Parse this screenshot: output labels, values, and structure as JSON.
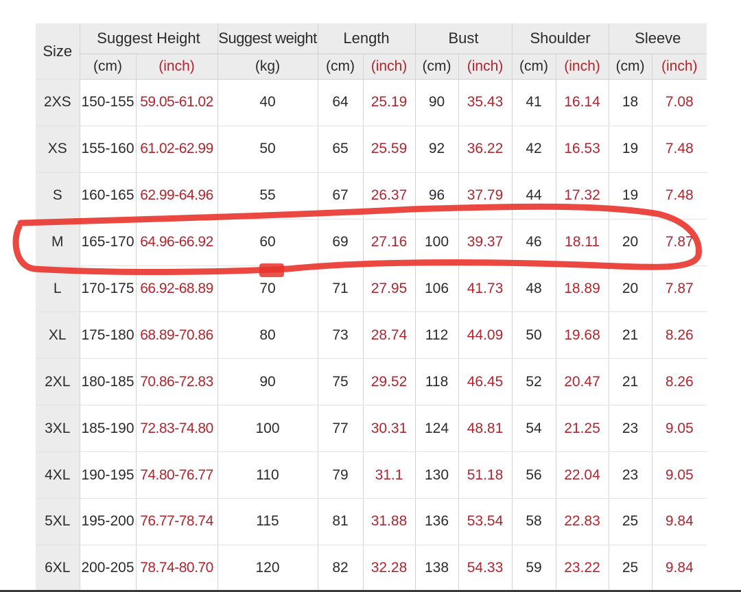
{
  "table": {
    "header": {
      "size": "Size",
      "suggest_height": "Suggest Height",
      "suggest_weight": "Suggest weight",
      "length": "Length",
      "bust": "Bust",
      "shoulder": "Shoulder",
      "sleeve": "Sleeve"
    },
    "units": {
      "height_cm": "(cm)",
      "height_inch": "(inch)",
      "weight_kg": "(kg)",
      "length_cm": "(cm)",
      "length_inch": "(inch)",
      "bust_cm": "(cm)",
      "bust_inch": "(inch)",
      "shoulder_cm": "(cm)",
      "shoulder_inch": "(inch)",
      "sleeve_cm": "(cm)",
      "sleeve_inch": "(inch)"
    },
    "rows": [
      {
        "size": "2XS",
        "height_cm": "150-155",
        "height_inch": "59.05-61.02",
        "weight_kg": "40",
        "length_cm": "64",
        "length_inch": "25.19",
        "bust_cm": "90",
        "bust_inch": "35.43",
        "shoulder_cm": "41",
        "shoulder_inch": "16.14",
        "sleeve_cm": "18",
        "sleeve_inch": "7.08"
      },
      {
        "size": "XS",
        "height_cm": "155-160",
        "height_inch": "61.02-62.99",
        "weight_kg": "50",
        "length_cm": "65",
        "length_inch": "25.59",
        "bust_cm": "92",
        "bust_inch": "36.22",
        "shoulder_cm": "42",
        "shoulder_inch": "16.53",
        "sleeve_cm": "19",
        "sleeve_inch": "7.48"
      },
      {
        "size": "S",
        "height_cm": "160-165",
        "height_inch": "62.99-64.96",
        "weight_kg": "55",
        "length_cm": "67",
        "length_inch": "26.37",
        "bust_cm": "96",
        "bust_inch": "37.79",
        "shoulder_cm": "44",
        "shoulder_inch": "17.32",
        "sleeve_cm": "19",
        "sleeve_inch": "7.48"
      },
      {
        "size": "M",
        "height_cm": "165-170",
        "height_inch": "64.96-66.92",
        "weight_kg": "60",
        "length_cm": "69",
        "length_inch": "27.16",
        "bust_cm": "100",
        "bust_inch": "39.37",
        "shoulder_cm": "46",
        "shoulder_inch": "18.11",
        "sleeve_cm": "20",
        "sleeve_inch": "7.87"
      },
      {
        "size": "L",
        "height_cm": "170-175",
        "height_inch": "66.92-68.89",
        "weight_kg": "70",
        "length_cm": "71",
        "length_inch": "27.95",
        "bust_cm": "106",
        "bust_inch": "41.73",
        "shoulder_cm": "48",
        "shoulder_inch": "18.89",
        "sleeve_cm": "20",
        "sleeve_inch": "7.87"
      },
      {
        "size": "XL",
        "height_cm": "175-180",
        "height_inch": "68.89-70.86",
        "weight_kg": "80",
        "length_cm": "73",
        "length_inch": "28.74",
        "bust_cm": "112",
        "bust_inch": "44.09",
        "shoulder_cm": "50",
        "shoulder_inch": "19.68",
        "sleeve_cm": "21",
        "sleeve_inch": "8.26"
      },
      {
        "size": "2XL",
        "height_cm": "180-185",
        "height_inch": "70.86-72.83",
        "weight_kg": "90",
        "length_cm": "75",
        "length_inch": "29.52",
        "bust_cm": "118",
        "bust_inch": "46.45",
        "shoulder_cm": "52",
        "shoulder_inch": "20.47",
        "sleeve_cm": "21",
        "sleeve_inch": "8.26"
      },
      {
        "size": "3XL",
        "height_cm": "185-190",
        "height_inch": "72.83-74.80",
        "weight_kg": "100",
        "length_cm": "77",
        "length_inch": "30.31",
        "bust_cm": "124",
        "bust_inch": "48.81",
        "shoulder_cm": "54",
        "shoulder_inch": "21.25",
        "sleeve_cm": "23",
        "sleeve_inch": "9.05"
      },
      {
        "size": "4XL",
        "height_cm": "190-195",
        "height_inch": "74.80-76.77",
        "weight_kg": "110",
        "length_cm": "79",
        "length_inch": "31.1",
        "bust_cm": "130",
        "bust_inch": "51.18",
        "shoulder_cm": "56",
        "shoulder_inch": "22.04",
        "sleeve_cm": "23",
        "sleeve_inch": "9.05"
      },
      {
        "size": "5XL",
        "height_cm": "195-200",
        "height_inch": "76.77-78.74",
        "weight_kg": "115",
        "length_cm": "81",
        "length_inch": "31.88",
        "bust_cm": "136",
        "bust_inch": "53.54",
        "shoulder_cm": "58",
        "shoulder_inch": "22.83",
        "sleeve_cm": "25",
        "sleeve_inch": "9.84"
      },
      {
        "size": "6XL",
        "height_cm": "200-205",
        "height_inch": "78.74-80.70",
        "weight_kg": "120",
        "length_cm": "82",
        "length_inch": "32.28",
        "bust_cm": "138",
        "bust_inch": "54.33",
        "shoulder_cm": "59",
        "shoulder_inch": "23.22",
        "sleeve_cm": "25",
        "sleeve_inch": "9.84"
      }
    ]
  },
  "highlight": {
    "row_size": "M",
    "color": "#e8342c"
  },
  "colors": {
    "inch_text": "#b0262e",
    "header_bg": "#ececec"
  }
}
